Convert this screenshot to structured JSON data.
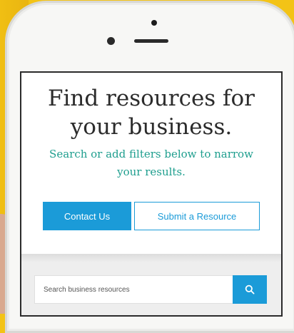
{
  "hero": {
    "title_line1": "Find resources for",
    "title_line2": "your business.",
    "subtitle_line1": "Search or add filters below to narrow",
    "subtitle_line2": "your results."
  },
  "buttons": {
    "contact_label": "Contact Us",
    "submit_label": "Submit a Resource"
  },
  "search": {
    "placeholder": "Search business resources",
    "button_icon": "search-icon"
  },
  "colors": {
    "accent_blue": "#1b9bd8",
    "subtitle_teal": "#1e9e8e",
    "background_yellow": "#f3c316"
  }
}
